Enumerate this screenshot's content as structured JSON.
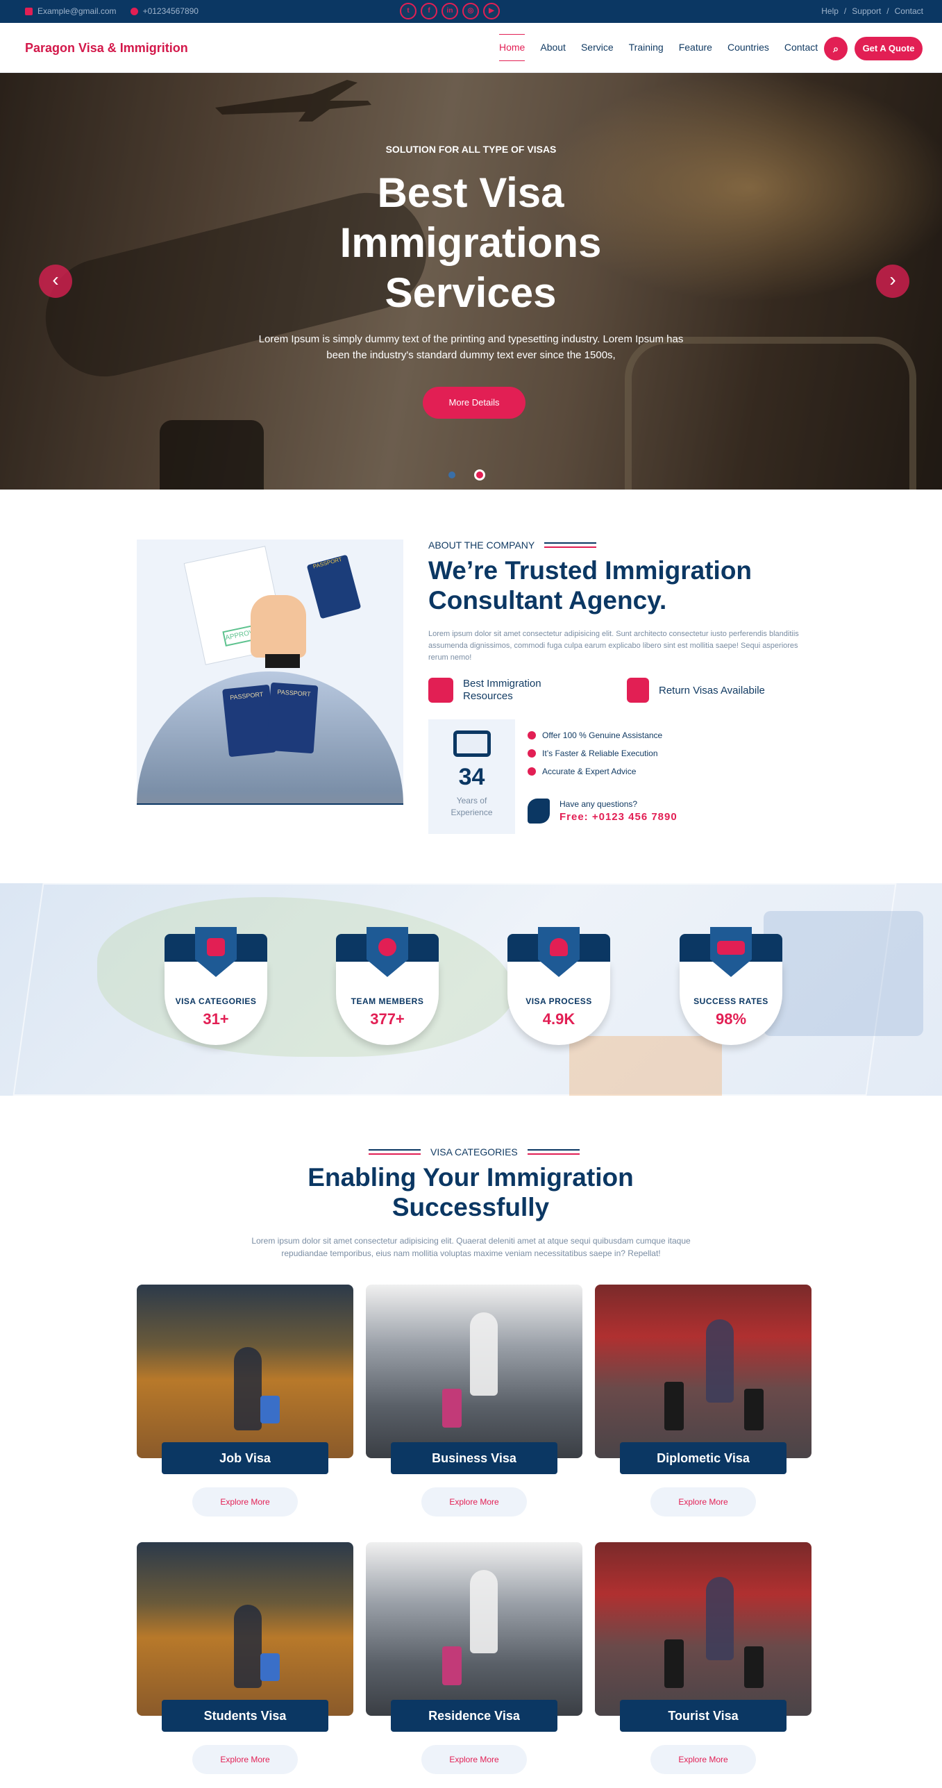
{
  "topbar": {
    "email": "Example@gmail.com",
    "phone": "+01234567890",
    "links": [
      "Help",
      "/",
      "Support",
      "/",
      "Contact"
    ]
  },
  "nav": {
    "logo": "Paragon Visa & Immigrition",
    "items": [
      "Home",
      "About",
      "Service",
      "Training",
      "Feature",
      "Countries",
      "Contact"
    ],
    "quote": "Get A Quote"
  },
  "hero": {
    "subtitle": "SOLUTION FOR ALL TYPE OF VISAS",
    "title": "Best Visa Immigrations Services",
    "text": "Lorem Ipsum is simply dummy text of the printing and typesetting industry. Lorem Ipsum has been the industry's standard dummy text ever since the 1500s,",
    "button": "More Details"
  },
  "about": {
    "label": "ABOUT THE COMPANY",
    "title": "We’re Trusted Immigration Consultant Agency.",
    "text": "Lorem ipsum dolor sit amet consectetur adipisicing elit. Sunt architecto consectetur iusto perferendis blanditiis assumenda dignissimos, commodi fuga culpa earum explicabo libero sint est mollitia saepe! Sequi asperiores rerum nemo!",
    "feature1": "Best Immigration Resources",
    "feature2": "Return Visas Availabile",
    "years": "34",
    "years_label": "Years of Experience",
    "checks": [
      "Offer 100 % Genuine Assistance",
      "It’s Faster & Reliable Execution",
      "Accurate & Expert Advice"
    ],
    "question": "Have any questions?",
    "phone": "Free: +0123 456 7890",
    "stamp": "APPROVED",
    "passport": "PASSPORT"
  },
  "stats": [
    {
      "label": "VISA CATEGORIES",
      "value": "31+"
    },
    {
      "label": "TEAM MEMBERS",
      "value": "377+"
    },
    {
      "label": "VISA PROCESS",
      "value": "4.9K"
    },
    {
      "label": "SUCCESS RATES",
      "value": "98%"
    }
  ],
  "visa": {
    "label": "VISA CATEGORIES",
    "title": "Enabling Your Immigration Successfully",
    "text": "Lorem ipsum dolor sit amet consectetur adipisicing elit. Quaerat deleniti amet at atque sequi quibusdam cumque itaque repudiandae temporibus, eius nam mollitia voluptas maxime veniam necessitatibus saepe in? Repellat!",
    "cards": [
      {
        "title": "Job Visa",
        "button": "Explore More"
      },
      {
        "title": "Business Visa",
        "button": "Explore More"
      },
      {
        "title": "Diplometic Visa",
        "button": "Explore More"
      },
      {
        "title": "Students Visa",
        "button": "Explore More"
      },
      {
        "title": "Residence Visa",
        "button": "Explore More"
      },
      {
        "title": "Tourist Visa",
        "button": "Explore More"
      }
    ]
  },
  "colors": {
    "primary": "#0b3763",
    "accent": "#e21f54"
  }
}
